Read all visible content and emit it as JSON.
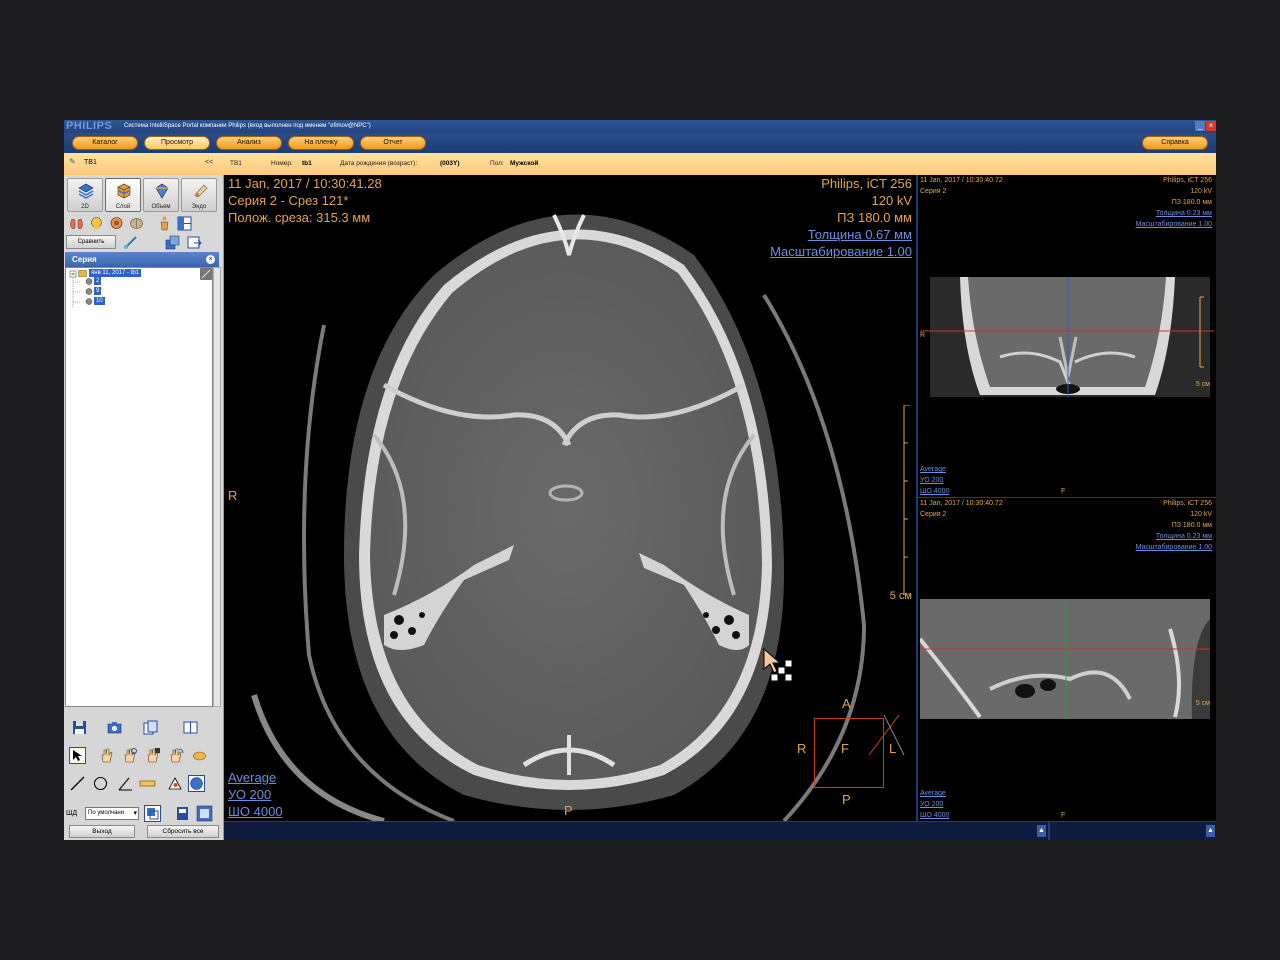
{
  "titlebar": {
    "brand": "PHILIPS",
    "title": "Система IntelliSpace Portal компании Philips (вход выполнен под именем \"efimov@NPC\")"
  },
  "tabs": [
    {
      "label": "Каталог"
    },
    {
      "label": "Просмотр"
    },
    {
      "label": "Анализ"
    },
    {
      "label": "На пленку"
    },
    {
      "label": "Отчет"
    }
  ],
  "help_tab": "Справка",
  "infobar": {
    "patient_short": "TB1",
    "collapse": "<<",
    "patient_id": "TB1",
    "number_label": "Номер:",
    "number_value": "tb1",
    "dob_label": "Дата рождения (возраст):",
    "dob_value": "(003Y)",
    "sex_label": "Пол:",
    "sex_value": "Мужской"
  },
  "left_panel": {
    "modes": [
      {
        "label": "2D",
        "icon": "2d-layers-icon"
      },
      {
        "label": "Слой",
        "icon": "slab-cube-icon"
      },
      {
        "label": "Объем",
        "icon": "volume-icon"
      },
      {
        "label": "Эндо",
        "icon": "endo-icon"
      }
    ],
    "compare_button": "Сравнить",
    "series_header": "Серия",
    "tree": {
      "study": "янв 11, 2017 - tb1",
      "series": [
        "2",
        "9",
        "10"
      ]
    },
    "wd_label": "ШД",
    "wd_value": "По умолчани",
    "exit_button": "Выход",
    "reset_button": "Сбросить все"
  },
  "main_viewport": {
    "datetime": "11 Jan, 2017 / 10:30:41.28",
    "series_slice": "Серия 2 - Срез 121*",
    "slice_pos": "Полож. среза: 315.3 мм",
    "scanner": "Philips, iCT 256",
    "kv": "120 kV",
    "fov": "ПЗ 180.0 мм",
    "thickness": "Толщина 0.67 мм",
    "zoom": "Масштабирование 1.00",
    "scale": "5 см",
    "orient_left": "R",
    "orient_bottom": "P",
    "mode": "Average",
    "wl": "УО   200",
    "ww": "ШО  4000",
    "cube": {
      "a": "A",
      "r": "R",
      "f": "F",
      "l": "L",
      "p": "P"
    }
  },
  "side_top": {
    "datetime": "11 Jan, 2017 / 10:30:40.72",
    "series": "Серия 2",
    "scanner": "Philips, iCT 256",
    "kv": "120 kV",
    "fov": "ПЗ 180.0 мм",
    "thickness": "Толщина 0.23 мм",
    "zoom": "Масштабирование 1.00",
    "orient_left": "R",
    "scale": "5 см",
    "mode": "Average",
    "wl": "УО    200",
    "ww": "ШО  4000",
    "orient_bottom": "F"
  },
  "side_bottom": {
    "datetime": "11 Jan, 2017 / 10:30:40.72",
    "series": "Серия 2",
    "scanner": "Philips, iCT 256",
    "kv": "120 kV",
    "fov": "ПЗ 180.0 мм",
    "thickness": "Толщина 0.23 мм",
    "zoom": "Масштабирование 1.00",
    "scale": "5 см",
    "mode": "Average",
    "wl": "УО    200",
    "ww": "ШО  4000",
    "orient_bottom": "F"
  },
  "colors": {
    "overlay_text": "#e2a451",
    "overlay_link": "#6c8ede",
    "tab_orange": "#f19a1c",
    "titlebar_blue": "#2f5596",
    "info_bar": "#ffd28a"
  }
}
